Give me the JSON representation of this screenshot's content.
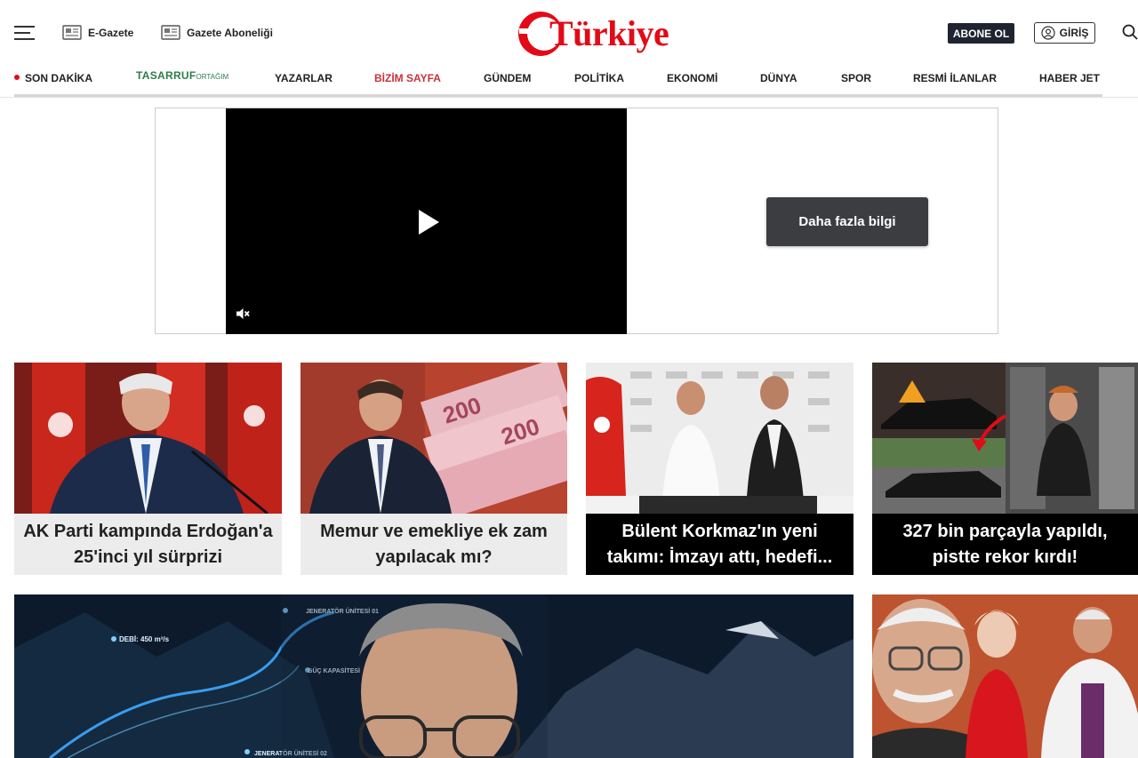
{
  "header": {
    "egazete_label": "E-Gazete",
    "abonelik_label": "Gazete Aboneliği",
    "logo_text": "Türkiye",
    "abone_label": "ABONE OL",
    "giris_label": "GİRİŞ"
  },
  "nav": {
    "son_dakika": "SON DAKİKA",
    "tasarruf": "TASARRUF",
    "tasarruf_small": "ORTAĞIM",
    "items": [
      "YAZARLAR",
      "BİZİM SAYFA",
      "GÜNDEM",
      "POLİTİKA",
      "EKONOMİ",
      "DÜNYA",
      "SPOR",
      "RESMİ İLANLAR",
      "HABER JET"
    ]
  },
  "ad": {
    "more_label": "Daha fazla bilgi"
  },
  "news": [
    {
      "title": "AK Parti kampında Erdoğan'a 25'inci yıl sürprizi"
    },
    {
      "title": "Memur ve emekliye ek zam yapılacak mı?"
    },
    {
      "title": "Bülent Korkmaz'ın yeni takımı: İmzayı attı, hedefi..."
    },
    {
      "title": "327 bin parçayla yapıldı, pistte rekor kırdı!"
    }
  ],
  "big_image": {
    "labels": [
      "DEBİ: 450 m³/s",
      "JENERATÖR ÜNİTESİ 01",
      "GÜÇ KAPASİTESİ",
      "JENERATÖR ÜNİTESİ 02"
    ]
  },
  "colors": {
    "brand_red": "#e30a17",
    "nav_red": "#c8323c",
    "tasarruf_green": "#2f7c4b",
    "abone_bg": "#1f2430"
  }
}
